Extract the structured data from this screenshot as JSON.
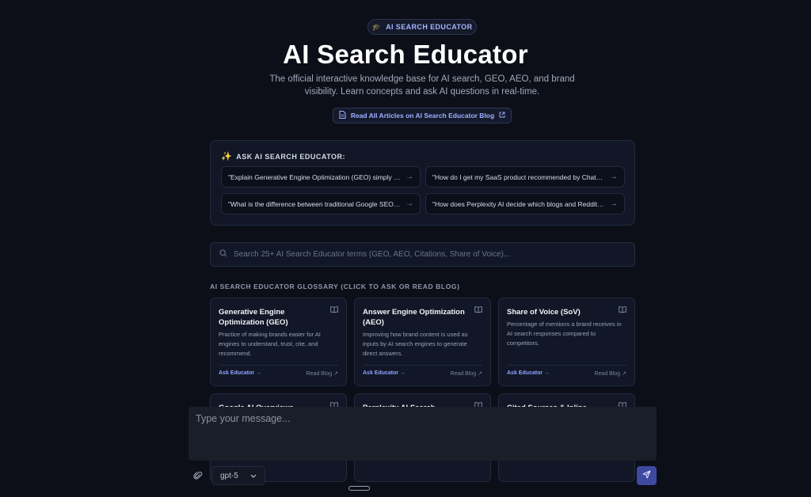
{
  "header": {
    "badge_icon": "graduation-cap-icon",
    "badge_label": "AI SEARCH EDUCATOR",
    "title": "AI Search Educator",
    "subtitle": "The official interactive knowledge base for AI search, GEO, AEO, and brand visibility. Learn concepts and ask AI questions in real-time.",
    "blog_button_label": "Read All Articles on AI Search Educator Blog"
  },
  "ask_panel": {
    "heading": "ASK AI SEARCH EDUCATOR:",
    "prompts": [
      "\"Explain Generative Engine Optimization (GEO) simply for a beginner\"",
      "\"How do I get my SaaS product recommended by ChatGPT?\"",
      "\"What is the difference between traditional Google SEO and AEO?\"",
      "\"How does Perplexity AI decide which blogs and Reddit threads to cite?\""
    ]
  },
  "search": {
    "placeholder": "Search 25+ AI Search Educator terms (GEO, AEO, Citations, Share of Voice)..."
  },
  "glossary": {
    "label": "AI SEARCH EDUCATOR GLOSSARY (CLICK TO ASK OR READ BLOG)",
    "ask_label": "Ask Educator",
    "blog_label": "Read Blog",
    "cards": [
      {
        "title": "Generative Engine Optimization (GEO)",
        "description": "Practice of making brands easier for AI engines to understand, trust, cite, and recommend."
      },
      {
        "title": "Answer Engine Optimization (AEO)",
        "description": "Improving how brand content is used as inputs by AI search engines to generate direct answers."
      },
      {
        "title": "Share of Voice (SoV)",
        "description": "Percentage of mentions a brand receives in AI search responses compared to competitors."
      },
      {
        "title": "Google AI Overviews",
        "description": ""
      },
      {
        "title": "Perplexity AI Search",
        "description": ""
      },
      {
        "title": "Cited Sources & Inline",
        "description": ""
      }
    ]
  },
  "composer": {
    "placeholder": "Type your message...",
    "model": "gpt-5"
  },
  "colors": {
    "background": "#0c0f17",
    "accent": "#8ea2ff",
    "send_button": "#4049a0"
  }
}
